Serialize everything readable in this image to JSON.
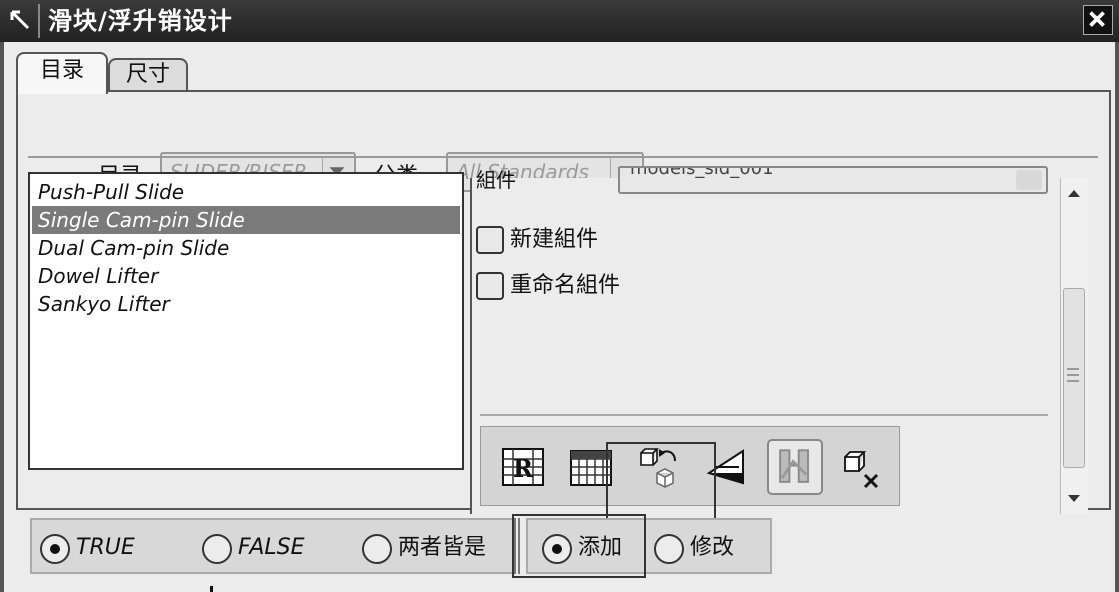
{
  "window": {
    "title": "滑块/浮升销设计",
    "close_label": "×"
  },
  "tabs": [
    {
      "label": "目录",
      "active": true
    },
    {
      "label": "尺寸",
      "active": false
    }
  ],
  "catalog": {
    "catalog_label": "目录",
    "catalog_value": "SLIDER/RISER",
    "category_label": "分类",
    "category_value": "All Standards"
  },
  "list": {
    "items": [
      "Push-Pull Slide",
      "Single Cam-pin Slide",
      "Dual Cam-pin Slide",
      "Dowel Lifter",
      "Sankyo Lifter"
    ],
    "selected_index": 1
  },
  "component": {
    "label": "組件",
    "value": "models_sld_001",
    "new_component_label": "新建組件",
    "rename_component_label": "重命名組件"
  },
  "toolbar": {
    "icons": [
      "table-r-icon",
      "grid-table-icon",
      "reposition-component-icon",
      "flip-direction-icon",
      "edit-data-icon",
      "delete-component-icon"
    ]
  },
  "options_left": {
    "true_label": "TRUE",
    "false_label": "FALSE",
    "both_label": "两者皆是",
    "selected": "TRUE"
  },
  "options_right": {
    "add_label": "添加",
    "modify_label": "修改",
    "selected": "添加"
  }
}
